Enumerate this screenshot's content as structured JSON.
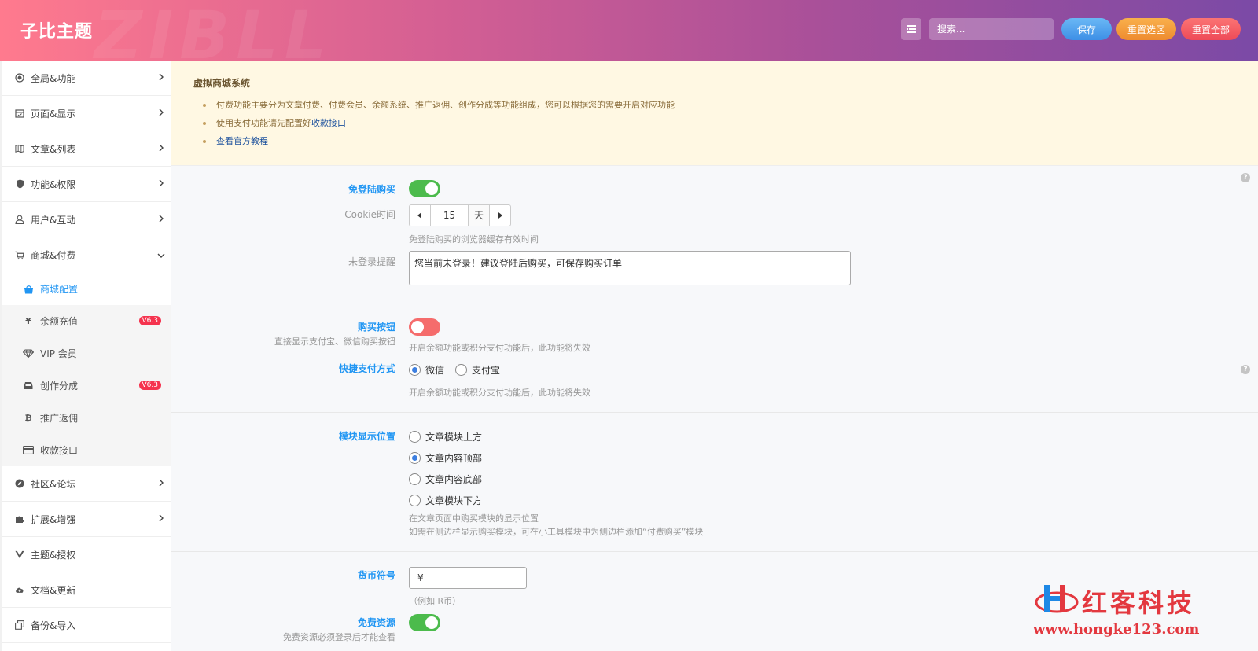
{
  "header": {
    "title": "子比主题",
    "watermark": "ZIBLL",
    "search_placeholder": "搜索...",
    "save_label": "保存",
    "reset_section_label": "重置选区",
    "reset_all_label": "重置全部"
  },
  "sidebar": {
    "items": [
      {
        "label": "全局&功能",
        "icon": "target-icon"
      },
      {
        "label": "页面&显示",
        "icon": "calendar-icon"
      },
      {
        "label": "文章&列表",
        "icon": "map-icon"
      },
      {
        "label": "功能&权限",
        "icon": "shield-icon"
      },
      {
        "label": "用户&互动",
        "icon": "user-icon"
      },
      {
        "label": "商城&付费",
        "icon": "cart-icon"
      },
      {
        "label": "社区&论坛",
        "icon": "compass-icon"
      },
      {
        "label": "扩展&增强",
        "icon": "puzzle-icon"
      },
      {
        "label": "主题&授权",
        "icon": "vuejs-icon"
      },
      {
        "label": "文档&更新",
        "icon": "cloud-icon"
      },
      {
        "label": "备份&导入",
        "icon": "copy-icon"
      }
    ],
    "subitems": [
      {
        "label": "商城配置",
        "icon": "shopping-bag-icon"
      },
      {
        "label": "余额充值",
        "icon": "yen-icon",
        "badge": "V6.3"
      },
      {
        "label": "VIP 会员",
        "icon": "diamond-icon"
      },
      {
        "label": "创作分成",
        "icon": "inbox-icon",
        "badge": "V6.3"
      },
      {
        "label": "推广返佣",
        "icon": "bitcoin-icon"
      },
      {
        "label": "收款接口",
        "icon": "credit-card-icon"
      }
    ]
  },
  "notice": {
    "title": "虚拟商城系统",
    "line1": "付费功能主要分为文章付费、付费会员、余额系统、推广返佣、创作分成等功能组成，您可以根据您的需要开启对应功能",
    "line2_prefix": "使用支付功能请先配置好",
    "line2_link": "收款接口",
    "line3_link": "查看官方教程"
  },
  "form": {
    "login_free": {
      "label": "免登陆购买",
      "enabled": true
    },
    "cookie": {
      "label": "Cookie时间",
      "value": "15",
      "unit": "天",
      "help": "免登陆购买的浏览器缓存有效时间"
    },
    "not_logged": {
      "label": "未登录提醒",
      "value": "您当前未登录！建议登陆后购买，可保存购买订单"
    },
    "buy_button": {
      "label": "购买按钮",
      "sublabel": "直接显示支付宝、微信购买按钮",
      "enabled": false,
      "help": "开启余额功能或积分支付功能后，此功能将失效"
    },
    "quick_pay": {
      "label": "快捷支付方式",
      "options": [
        "微信",
        "支付宝"
      ],
      "selected": 0,
      "help": "开启余额功能或积分支付功能后，此功能将失效"
    },
    "module_pos": {
      "label": "模块显示位置",
      "options": [
        "文章模块上方",
        "文章内容顶部",
        "文章内容底部",
        "文章模块下方"
      ],
      "selected": 1,
      "help1": "在文章页面中购买模块的显示位置",
      "help2": "如需在侧边栏显示购买模块，可在小工具模块中为侧边栏添加“付费购买”模块"
    },
    "currency": {
      "label": "货币符号",
      "value": "¥",
      "help": "（例如 R币）"
    },
    "free_res": {
      "label": "免费资源",
      "sublabel": "免费资源必须登录后才能查看",
      "enabled": true
    }
  },
  "help_mark": "?",
  "brand": {
    "name": "红客科技",
    "url": "www.hongke123.com"
  },
  "colors": {
    "accent": "#2196f3",
    "toggle_on": "#4cbb4c",
    "toggle_off": "#f56c6c",
    "badge": "#f5334e",
    "brand_red": "#e3383f"
  }
}
